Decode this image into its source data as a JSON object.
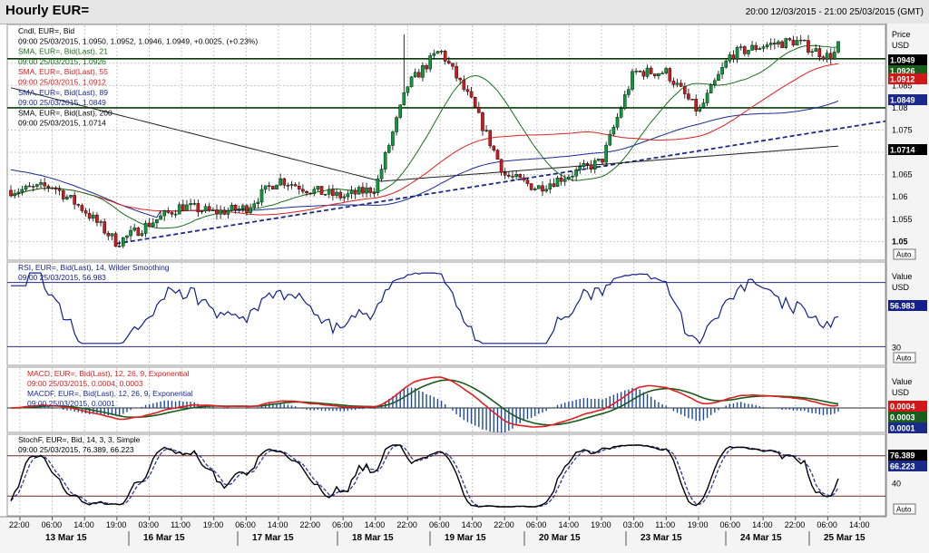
{
  "header": {
    "title": "Hourly EUR=",
    "range": "20:00 12/03/2015 - 21:00 25/03/2015 (GMT)"
  },
  "colors": {
    "candle_up": "#0a9a3a",
    "candle_down": "#d0181e",
    "sma21": "#1b6e1b",
    "sma55": "#e02020",
    "sma89": "#1a2a9a",
    "sma200": "#202020",
    "rsi": "#14208a",
    "macd": "#e02020",
    "macdf": "#1a5a1a",
    "hist": "#1a4aa0",
    "stoch_k": "#000000",
    "stoch_d": "#2a3a9a",
    "trend": "#1a2a8a",
    "hline": "#0a3a0a"
  },
  "price_panel": {
    "legend": [
      {
        "text": "Cndl, EUR=, Bid",
        "color": "#000000"
      },
      {
        "text": "09:00 25/03/2015, 1.0950, 1.0952, 1.0946, 1.0949, +0.0025, (+0.23%)",
        "color": "#000000"
      },
      {
        "text": "SMA, EUR=, Bid(Last), 21",
        "color": "#1b6e1b"
      },
      {
        "text": "09:00 25/03/2015, 1.0926",
        "color": "#1b6e1b"
      },
      {
        "text": "SMA, EUR=, Bid(Last), 55",
        "color": "#e02020"
      },
      {
        "text": "09:00 25/03/2015, 1.0912",
        "color": "#e02020"
      },
      {
        "text": "SMA, EUR=, Bid(Last), 89",
        "color": "#1a2a9a"
      },
      {
        "text": "09:00 25/03/2015, 1.0849",
        "color": "#1a2a9a"
      },
      {
        "text": "SMA, EUR=, Bid(Last), 200",
        "color": "#000000"
      },
      {
        "text": "09:00 25/03/2015, 1.0714",
        "color": "#000000"
      }
    ],
    "axis_title": [
      "Price",
      "USD"
    ],
    "ticks": [
      "1.09",
      "1.085",
      "1.08",
      "1.075",
      "1.07",
      "1.065",
      "1.06",
      "1.055",
      "1.05"
    ],
    "tags": [
      {
        "label": "1.0949",
        "value": 1.0949,
        "bg": "#000000",
        "fg": "#ffffff"
      },
      {
        "label": "1.0926",
        "value": 1.0926,
        "bg": "#1b5e1b",
        "fg": "#ffffff"
      },
      {
        "label": "1.0912",
        "value": 1.0912,
        "bg": "#d01818",
        "fg": "#ffffff"
      },
      {
        "label": "1.0849",
        "value": 1.0849,
        "bg": "#1a2a8a",
        "fg": "#ffffff"
      },
      {
        "label": "1.0714",
        "value": 1.0714,
        "bg": "#000000",
        "fg": "#ffffff"
      }
    ],
    "auto": "Auto"
  },
  "rsi_panel": {
    "legend": [
      {
        "text": "RSI, EUR=, Bid(Last), 14, Wilder Smoothing",
        "color": "#14208a"
      },
      {
        "text": "09:00 25/03/2015, 56.983",
        "color": "#14208a"
      }
    ],
    "axis_title": [
      "Value",
      "USD"
    ],
    "ticks": [
      "30"
    ],
    "tag": {
      "label": "56.983",
      "value": 56.983,
      "bg": "#14208a",
      "fg": "#ffffff"
    },
    "auto": "Auto"
  },
  "macd_panel": {
    "legend": [
      {
        "text": "MACD, EUR=, Bid(Last), 12, 26, 9, Exponential",
        "color": "#e02020"
      },
      {
        "text": "09:00 25/03/2015, 0.0004, 0.0003",
        "color": "#e02020"
      },
      {
        "text": "MACDF, EUR=, Bid(Last), 12, 26, 9, Exponential",
        "color": "#1a2a9a"
      },
      {
        "text": "09:00 25/03/2015, 0.0001",
        "color": "#1a2a9a"
      }
    ],
    "axis_title": [
      "Value",
      "USD"
    ],
    "tags": [
      {
        "label": "0.0004",
        "bg": "#d01818",
        "fg": "#ffffff"
      },
      {
        "label": "0.0003",
        "bg": "#1b5e1b",
        "fg": "#ffffff"
      },
      {
        "label": "0.0001",
        "bg": "#1a2a8a",
        "fg": "#ffffff"
      }
    ],
    "auto": "Auto"
  },
  "stoch_panel": {
    "legend": [
      {
        "text": "StochF, EUR=, Bid, 14, 3, 3, Simple",
        "color": "#000000"
      },
      {
        "text": "09:00 25/03/2015, 76.389, 66.223",
        "color": "#000000"
      }
    ],
    "ticks": [
      "40"
    ],
    "tags": [
      {
        "label": "76.389",
        "value": 76.389,
        "bg": "#000000",
        "fg": "#ffffff"
      },
      {
        "label": "66.223",
        "value": 66.223,
        "bg": "#1a2a8a",
        "fg": "#ffffff"
      }
    ],
    "auto": "Auto"
  },
  "xaxis": {
    "times": [
      "22:00",
      "06:00",
      "14:00",
      "19:00",
      "03:00",
      "11:00",
      "19:00",
      "06:00",
      "14:00",
      "22:00",
      "06:00",
      "14:00",
      "22:00",
      "06:00",
      "14:00",
      "22:00",
      "06:00",
      "14:00",
      "19:00",
      "03:00",
      "11:00",
      "19:00",
      "06:00",
      "14:00",
      "22:00",
      "06:00",
      "14:00"
    ],
    "dates": [
      "13 Mar 15",
      "16 Mar 15",
      "17 Mar 15",
      "18 Mar 15",
      "19 Mar 15",
      "20 Mar 15",
      "23 Mar 15",
      "24 Mar 15",
      "25 Mar 15"
    ]
  },
  "chart_data": {
    "type": "line",
    "title": "Hourly EUR=",
    "x_range": [
      "20:00 12/03/2015",
      "21:00 25/03/2015"
    ],
    "price": {
      "ylim": [
        1.046,
        1.0985
      ],
      "close_path": [
        [
          "12 Mar 22:00",
          1.0615
        ],
        [
          "13 Mar 06:00",
          1.0625
        ],
        [
          "13 Mar 14:00",
          1.057
        ],
        [
          "13 Mar 19:00",
          1.0497
        ],
        [
          "16 Mar 03:00",
          1.054
        ],
        [
          "16 Mar 11:00",
          1.058
        ],
        [
          "16 Mar 19:00",
          1.0565
        ],
        [
          "17 Mar 06:00",
          1.0575
        ],
        [
          "17 Mar 14:00",
          1.064
        ],
        [
          "17 Mar 22:00",
          1.0615
        ],
        [
          "18 Mar 06:00",
          1.06
        ],
        [
          "18 Mar 14:00",
          1.062
        ],
        [
          "18 Mar 19:00",
          1.085
        ],
        [
          "18 Mar 22:00",
          1.093
        ],
        [
          "19 Mar 06:00",
          1.081
        ],
        [
          "19 Mar 14:00",
          1.065
        ],
        [
          "19 Mar 22:00",
          1.062
        ],
        [
          "20 Mar 06:00",
          1.065
        ],
        [
          "20 Mar 14:00",
          1.068
        ],
        [
          "20 Mar 19:00",
          1.088
        ],
        [
          "23 Mar 03:00",
          1.088
        ],
        [
          "23 Mar 11:00",
          1.079
        ],
        [
          "23 Mar 19:00",
          1.092
        ],
        [
          "24 Mar 06:00",
          1.094
        ],
        [
          "24 Mar 14:00",
          1.095
        ],
        [
          "24 Mar 22:00",
          1.0915
        ],
        [
          "25 Mar 09:00",
          1.0949
        ]
      ],
      "support_lines": [
        1.091,
        1.08
      ],
      "trendline": {
        "from": [
          "13 Mar 19:00",
          1.0495
        ],
        "to": [
          "25 Mar 21:00",
          1.077
        ]
      },
      "sma_last": {
        "sma21": 1.0926,
        "sma55": 1.0912,
        "sma89": 1.0849,
        "sma200": 1.0714
      }
    },
    "rsi": {
      "period": 14,
      "last": 56.983,
      "reference_levels": [
        70,
        30
      ]
    },
    "macd": {
      "fast": 12,
      "slow": 26,
      "signal": 9,
      "macd_last": 0.0004,
      "signal_last": 0.0003,
      "histogram_last": 0.0001
    },
    "stochastic": {
      "k_last": 76.389,
      "d_last": 66.223,
      "levels": [
        80,
        20
      ]
    }
  }
}
